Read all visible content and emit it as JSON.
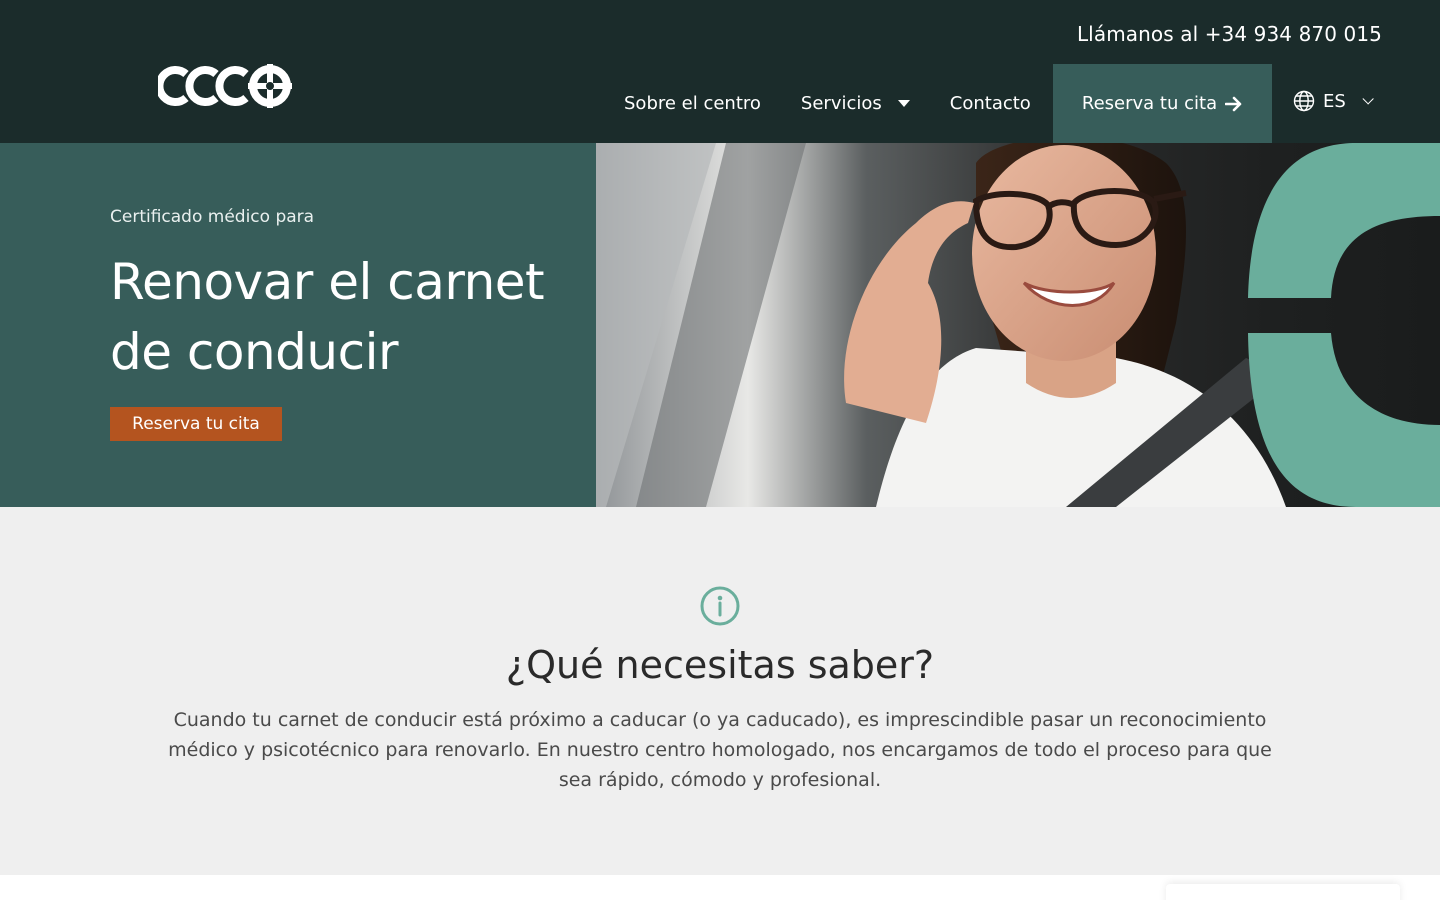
{
  "header": {
    "phone_text": "Llámanos al +34 934 870 015",
    "logo_icon": "ccco-logo",
    "nav": [
      {
        "label": "Sobre el centro"
      },
      {
        "label": "Servicios",
        "has_dropdown": true
      },
      {
        "label": "Contacto"
      }
    ],
    "cta_label": "Reserva tu cita",
    "cta_icon": "arrow-right-icon",
    "language": "ES",
    "language_icon": "globe-icon",
    "colors": {
      "background": "#1b2c2b",
      "cta_background": "#375d5a"
    }
  },
  "hero": {
    "subtitle": "Certificado médico para",
    "title": "Renovar el carnet de conducir",
    "button_label": "Reserva tu cita",
    "image_description_icon": "woman-driver-photo",
    "colors": {
      "panel": "#375d5a",
      "button": "#b4541f",
      "accent_shape": "#6aae9c"
    }
  },
  "info": {
    "icon": "info-icon",
    "title": "¿Qué necesitas saber?",
    "text": "Cuando tu carnet de conducir está próximo a caducar (o ya caducado), es imprescindible pasar un reconocimiento médico y psicotécnico para renovarlo. En nuestro centro homologado, nos encargamos de todo el proceso para que sea rápido, cómodo y profesional.",
    "colors": {
      "icon": "#6aae9c",
      "background": "#efefef"
    }
  }
}
